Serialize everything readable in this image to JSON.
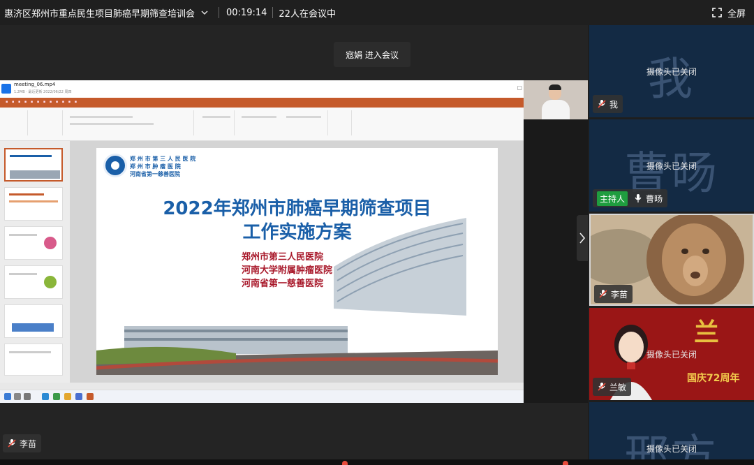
{
  "topbar": {
    "meeting_title": "惠济区郑州市重点民生项目肺癌早期筛查培训会",
    "timer": "00:19:14",
    "participants": "22人在会议中",
    "fullscreen_label": "全屏"
  },
  "toast": "寇娟 进入会议",
  "share": {
    "file_name": "meeting_06.mp4",
    "file_meta": "1.2MB · 最近更新 2022/06/22 周四",
    "slide": {
      "logo_line1": "郑 州 市 第 三 人 民 医 院",
      "logo_line2": "郑 州 市 肿 瘤 医 院",
      "logo_line3": "河南省第一慈善医院",
      "title_line1": "2022年郑州市肺癌早期筛查项目",
      "title_line2": "工作实施方案",
      "hospitals": [
        "郑州市第三人民医院",
        "河南大学附属肿瘤医院",
        "河南省第一慈善医院"
      ]
    }
  },
  "stage_name_tag": "李苗",
  "gallery": [
    {
      "big_name": "我",
      "status": "摄像头已关闭",
      "name": "我",
      "host": false,
      "mic": "muted",
      "camera_on": false
    },
    {
      "big_name": "曹旸",
      "status": "摄像头已关闭",
      "name": "曹旸",
      "host": true,
      "host_label": "主持人",
      "mic": "on",
      "camera_on": false
    },
    {
      "big_name": "",
      "status": "",
      "name": "李苗",
      "host": false,
      "mic": "muted",
      "camera_on": true,
      "active": true
    },
    {
      "big_name": "兰",
      "status": "摄像头已关闭",
      "name": "兰敏",
      "host": false,
      "mic": "muted",
      "camera_on": false,
      "bg_text": "国庆72周年"
    },
    {
      "big_name": "邢方",
      "status": "摄像头已关闭",
      "name": "",
      "host": false,
      "camera_on": false
    }
  ],
  "colors": {
    "accent_orange": "#c55a2b",
    "slide_title_blue": "#1a5fa8",
    "slide_hospital_red": "#a8182a",
    "host_badge_green": "#1f9d3f",
    "muted_mic_red": "#e74c3c"
  }
}
